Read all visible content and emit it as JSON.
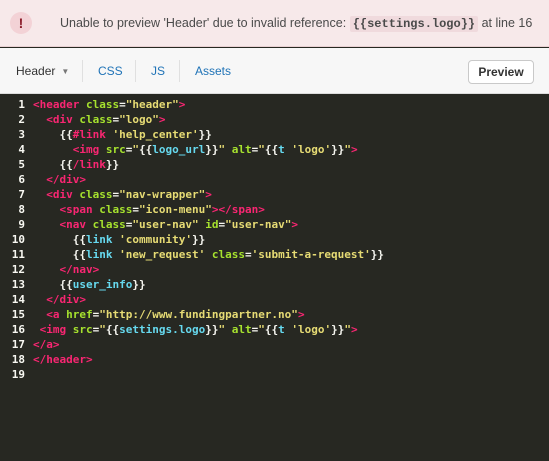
{
  "alert": {
    "icon": "exclamation-icon",
    "icon_glyph": "!",
    "message_prefix": "Unable to preview 'Header' due to invalid reference:",
    "reference": "{{settings.logo}}",
    "message_suffix": "at line 16"
  },
  "toolbar": {
    "template_select": "Header",
    "tabs": [
      "CSS",
      "JS",
      "Assets"
    ],
    "preview_label": "Preview"
  },
  "editor": {
    "line_numbers": [
      "1",
      "2",
      "3",
      "4",
      "5",
      "6",
      "7",
      "8",
      "9",
      "10",
      "11",
      "12",
      "13",
      "14",
      "15",
      "16",
      "17",
      "18",
      "19"
    ],
    "lines": [
      [
        {
          "t": "<header ",
          "c": "tag"
        },
        {
          "t": "class",
          "c": "attr"
        },
        {
          "t": "=",
          "c": "plain"
        },
        {
          "t": "\"header\"",
          "c": "str"
        },
        {
          "t": ">",
          "c": "tag"
        }
      ],
      [
        {
          "t": "  <div ",
          "c": "tag"
        },
        {
          "t": "class",
          "c": "attr"
        },
        {
          "t": "=",
          "c": "plain"
        },
        {
          "t": "\"logo\"",
          "c": "str"
        },
        {
          "t": ">",
          "c": "tag"
        }
      ],
      [
        {
          "t": "    {{",
          "c": "plain"
        },
        {
          "t": "#link",
          "c": "hbkw"
        },
        {
          "t": " ",
          "c": "plain"
        },
        {
          "t": "'help_center'",
          "c": "str"
        },
        {
          "t": "}}",
          "c": "plain"
        }
      ],
      [
        {
          "t": "      <img ",
          "c": "tag"
        },
        {
          "t": "src",
          "c": "attr"
        },
        {
          "t": "=",
          "c": "plain"
        },
        {
          "t": "\"",
          "c": "str"
        },
        {
          "t": "{{",
          "c": "plain"
        },
        {
          "t": "logo_url",
          "c": "hbname"
        },
        {
          "t": "}}",
          "c": "plain"
        },
        {
          "t": "\"",
          "c": "str"
        },
        {
          "t": " alt",
          "c": "attr"
        },
        {
          "t": "=",
          "c": "plain"
        },
        {
          "t": "\"",
          "c": "str"
        },
        {
          "t": "{{",
          "c": "plain"
        },
        {
          "t": "t ",
          "c": "hbname"
        },
        {
          "t": "'logo'",
          "c": "str"
        },
        {
          "t": "}}",
          "c": "plain"
        },
        {
          "t": "\"",
          "c": "str"
        },
        {
          "t": ">",
          "c": "tag"
        }
      ],
      [
        {
          "t": "    {{",
          "c": "plain"
        },
        {
          "t": "/link",
          "c": "hbkw"
        },
        {
          "t": "}}",
          "c": "plain"
        }
      ],
      [
        {
          "t": "  </div>",
          "c": "tag"
        }
      ],
      [
        {
          "t": "  <div ",
          "c": "tag"
        },
        {
          "t": "class",
          "c": "attr"
        },
        {
          "t": "=",
          "c": "plain"
        },
        {
          "t": "\"nav-wrapper\"",
          "c": "str"
        },
        {
          "t": ">",
          "c": "tag"
        }
      ],
      [
        {
          "t": "    <span ",
          "c": "tag"
        },
        {
          "t": "class",
          "c": "attr"
        },
        {
          "t": "=",
          "c": "plain"
        },
        {
          "t": "\"icon-menu\"",
          "c": "str"
        },
        {
          "t": "></span>",
          "c": "tag"
        }
      ],
      [
        {
          "t": "    <nav ",
          "c": "tag"
        },
        {
          "t": "class",
          "c": "attr"
        },
        {
          "t": "=",
          "c": "plain"
        },
        {
          "t": "\"user-nav\"",
          "c": "str"
        },
        {
          "t": " id",
          "c": "attr"
        },
        {
          "t": "=",
          "c": "plain"
        },
        {
          "t": "\"user-nav\"",
          "c": "str"
        },
        {
          "t": ">",
          "c": "tag"
        }
      ],
      [
        {
          "t": "      {{",
          "c": "plain"
        },
        {
          "t": "link ",
          "c": "hbname"
        },
        {
          "t": "'community'",
          "c": "str"
        },
        {
          "t": "}}",
          "c": "plain"
        }
      ],
      [
        {
          "t": "      {{",
          "c": "plain"
        },
        {
          "t": "link ",
          "c": "hbname"
        },
        {
          "t": "'new_request'",
          "c": "str"
        },
        {
          "t": " class",
          "c": "attr"
        },
        {
          "t": "=",
          "c": "plain"
        },
        {
          "t": "'submit-a-request'",
          "c": "str"
        },
        {
          "t": "}}",
          "c": "plain"
        }
      ],
      [
        {
          "t": "    </nav>",
          "c": "tag"
        }
      ],
      [
        {
          "t": "    {{",
          "c": "plain"
        },
        {
          "t": "user_info",
          "c": "hbname"
        },
        {
          "t": "}}",
          "c": "plain"
        }
      ],
      [
        {
          "t": "  </div>",
          "c": "tag"
        }
      ],
      [
        {
          "t": "  <a ",
          "c": "tag"
        },
        {
          "t": "href",
          "c": "attr"
        },
        {
          "t": "=",
          "c": "plain"
        },
        {
          "t": "\"http://www.fundingpartner.no\"",
          "c": "str"
        },
        {
          "t": ">",
          "c": "tag"
        }
      ],
      [
        {
          "t": " <img ",
          "c": "tag"
        },
        {
          "t": "src",
          "c": "attr"
        },
        {
          "t": "=",
          "c": "plain"
        },
        {
          "t": "\"",
          "c": "str"
        },
        {
          "t": "{{",
          "c": "plain"
        },
        {
          "t": "settings.logo",
          "c": "hbname"
        },
        {
          "t": "}}",
          "c": "plain"
        },
        {
          "t": "\"",
          "c": "str"
        },
        {
          "t": " alt",
          "c": "attr"
        },
        {
          "t": "=",
          "c": "plain"
        },
        {
          "t": "\"",
          "c": "str"
        },
        {
          "t": "{{",
          "c": "plain"
        },
        {
          "t": "t ",
          "c": "hbname"
        },
        {
          "t": "'logo'",
          "c": "str"
        },
        {
          "t": "}}",
          "c": "plain"
        },
        {
          "t": "\"",
          "c": "str"
        },
        {
          "t": ">",
          "c": "tag"
        }
      ],
      [
        {
          "t": "</a>",
          "c": "tag"
        }
      ],
      [
        {
          "t": "</header>",
          "c": "tag"
        }
      ],
      []
    ]
  }
}
